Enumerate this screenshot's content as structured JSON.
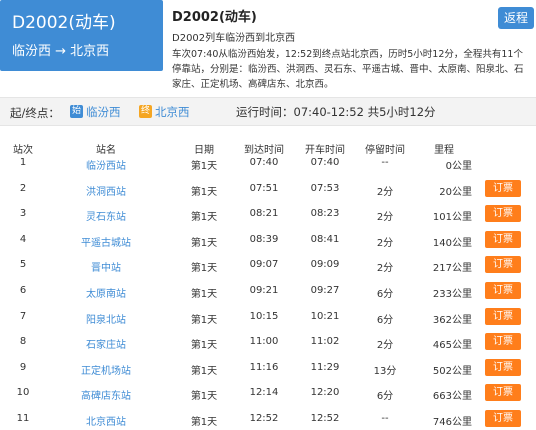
{
  "header": {
    "train_code": "D2002(动车)",
    "route": "临汾西 → 北京西",
    "title": "D2002(动车)",
    "subtitle": "D2002列车临汾西到北京西",
    "description": "车次07:40从临汾西始发，12:52到终点站北京西，历时5小时12分，全程共有11个停靠站，分别是：临汾西、洪洞西、灵石东、平遥古城、晋中、太原南、阳泉北、石家庄、正定机场、高碑店东、北京西。",
    "back_label": "返程"
  },
  "summary": {
    "label": "起/终点：",
    "start_badge": "始",
    "start_station": "临汾西",
    "end_badge": "终",
    "end_station": "北京西",
    "runtime": "运行时间：07:40-12:52 共5小时12分"
  },
  "columns": [
    "站次",
    "站名",
    "日期",
    "到达时间",
    "开车时间",
    "停留时间",
    "里程"
  ],
  "book_label": "订票",
  "stops": [
    {
      "no": "1",
      "name": "临汾西站",
      "day": "第1天",
      "arrive": "07:40",
      "depart": "07:40",
      "stay": "--",
      "dist": "0公里",
      "book": false
    },
    {
      "no": "2",
      "name": "洪洞西站",
      "day": "第1天",
      "arrive": "07:51",
      "depart": "07:53",
      "stay": "2分",
      "dist": "20公里",
      "book": true
    },
    {
      "no": "3",
      "name": "灵石东站",
      "day": "第1天",
      "arrive": "08:21",
      "depart": "08:23",
      "stay": "2分",
      "dist": "101公里",
      "book": true
    },
    {
      "no": "4",
      "name": "平遥古城站",
      "day": "第1天",
      "arrive": "08:39",
      "depart": "08:41",
      "stay": "2分",
      "dist": "140公里",
      "book": true
    },
    {
      "no": "5",
      "name": "晋中站",
      "day": "第1天",
      "arrive": "09:07",
      "depart": "09:09",
      "stay": "2分",
      "dist": "217公里",
      "book": true
    },
    {
      "no": "6",
      "name": "太原南站",
      "day": "第1天",
      "arrive": "09:21",
      "depart": "09:27",
      "stay": "6分",
      "dist": "233公里",
      "book": true
    },
    {
      "no": "7",
      "name": "阳泉北站",
      "day": "第1天",
      "arrive": "10:15",
      "depart": "10:21",
      "stay": "6分",
      "dist": "362公里",
      "book": true
    },
    {
      "no": "8",
      "name": "石家庄站",
      "day": "第1天",
      "arrive": "11:00",
      "depart": "11:02",
      "stay": "2分",
      "dist": "465公里",
      "book": true
    },
    {
      "no": "9",
      "name": "正定机场站",
      "day": "第1天",
      "arrive": "11:16",
      "depart": "11:29",
      "stay": "13分",
      "dist": "502公里",
      "book": true
    },
    {
      "no": "10",
      "name": "高碑店东站",
      "day": "第1天",
      "arrive": "12:14",
      "depart": "12:20",
      "stay": "6分",
      "dist": "663公里",
      "book": true
    },
    {
      "no": "11",
      "name": "北京西站",
      "day": "第1天",
      "arrive": "12:52",
      "depart": "12:52",
      "stay": "--",
      "dist": "746公里",
      "book": true
    }
  ]
}
